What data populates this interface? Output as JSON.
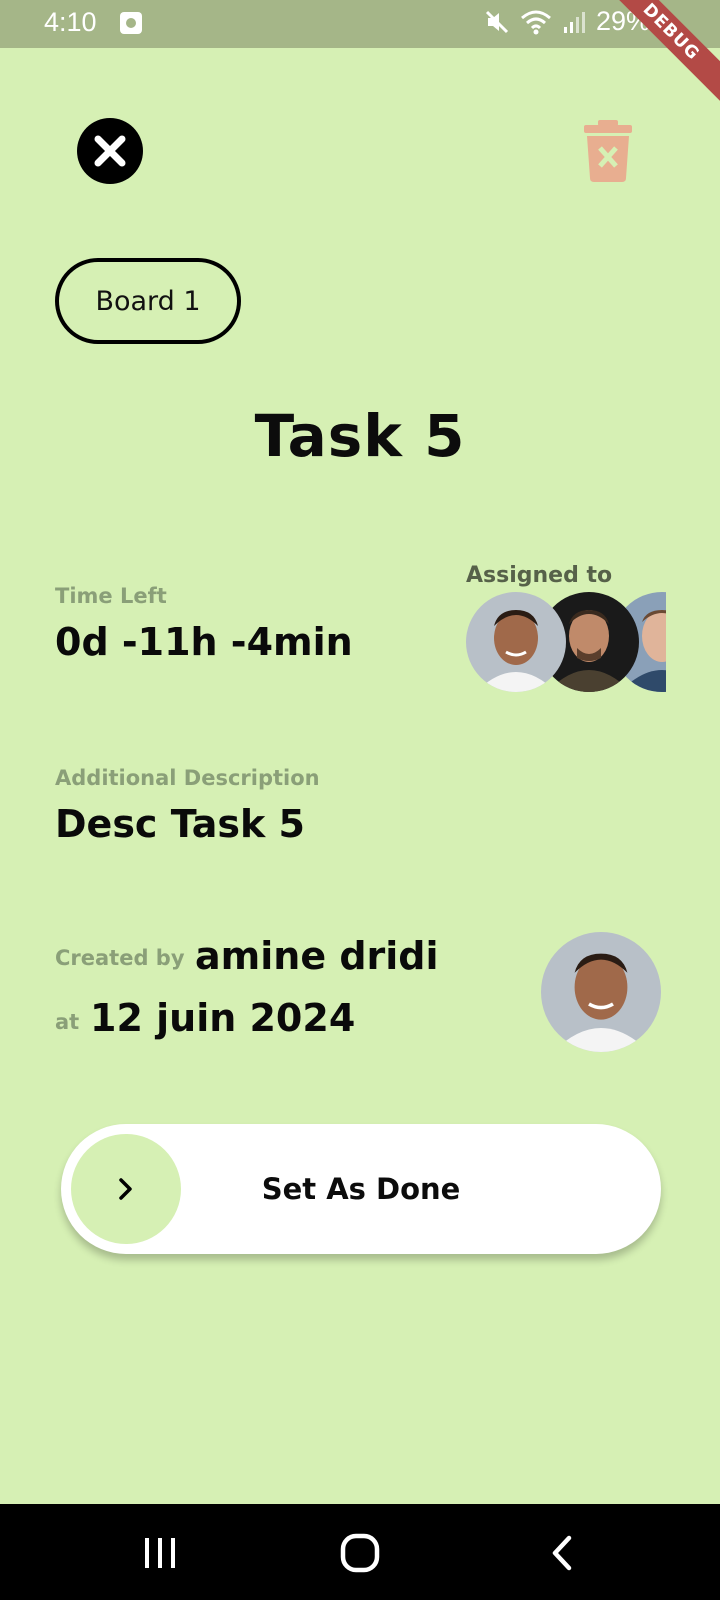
{
  "status_bar": {
    "time": "4:10",
    "battery": "29%",
    "debug_banner": "DEBUG"
  },
  "task": {
    "board": "Board 1",
    "title": "Task 5",
    "time_left_label": "Time Left",
    "time_left": "0d -11h -4min",
    "assigned_label": "Assigned to",
    "description_label": "Additional Description",
    "description": "Desc Task 5",
    "created_by_label": "Created by",
    "created_by": "amine dridi",
    "at_label": "at",
    "created_at": "12 juin 2024"
  },
  "action": {
    "slider_label": "Set As Done"
  },
  "icons": {
    "close": "close-icon",
    "delete": "trash-icon",
    "slider": "chevron-right-icon"
  },
  "colors": {
    "background": "#d6f0b4",
    "status_bar": "#a5b688",
    "trash": "#e8ae90",
    "debug": "#b34a46"
  }
}
